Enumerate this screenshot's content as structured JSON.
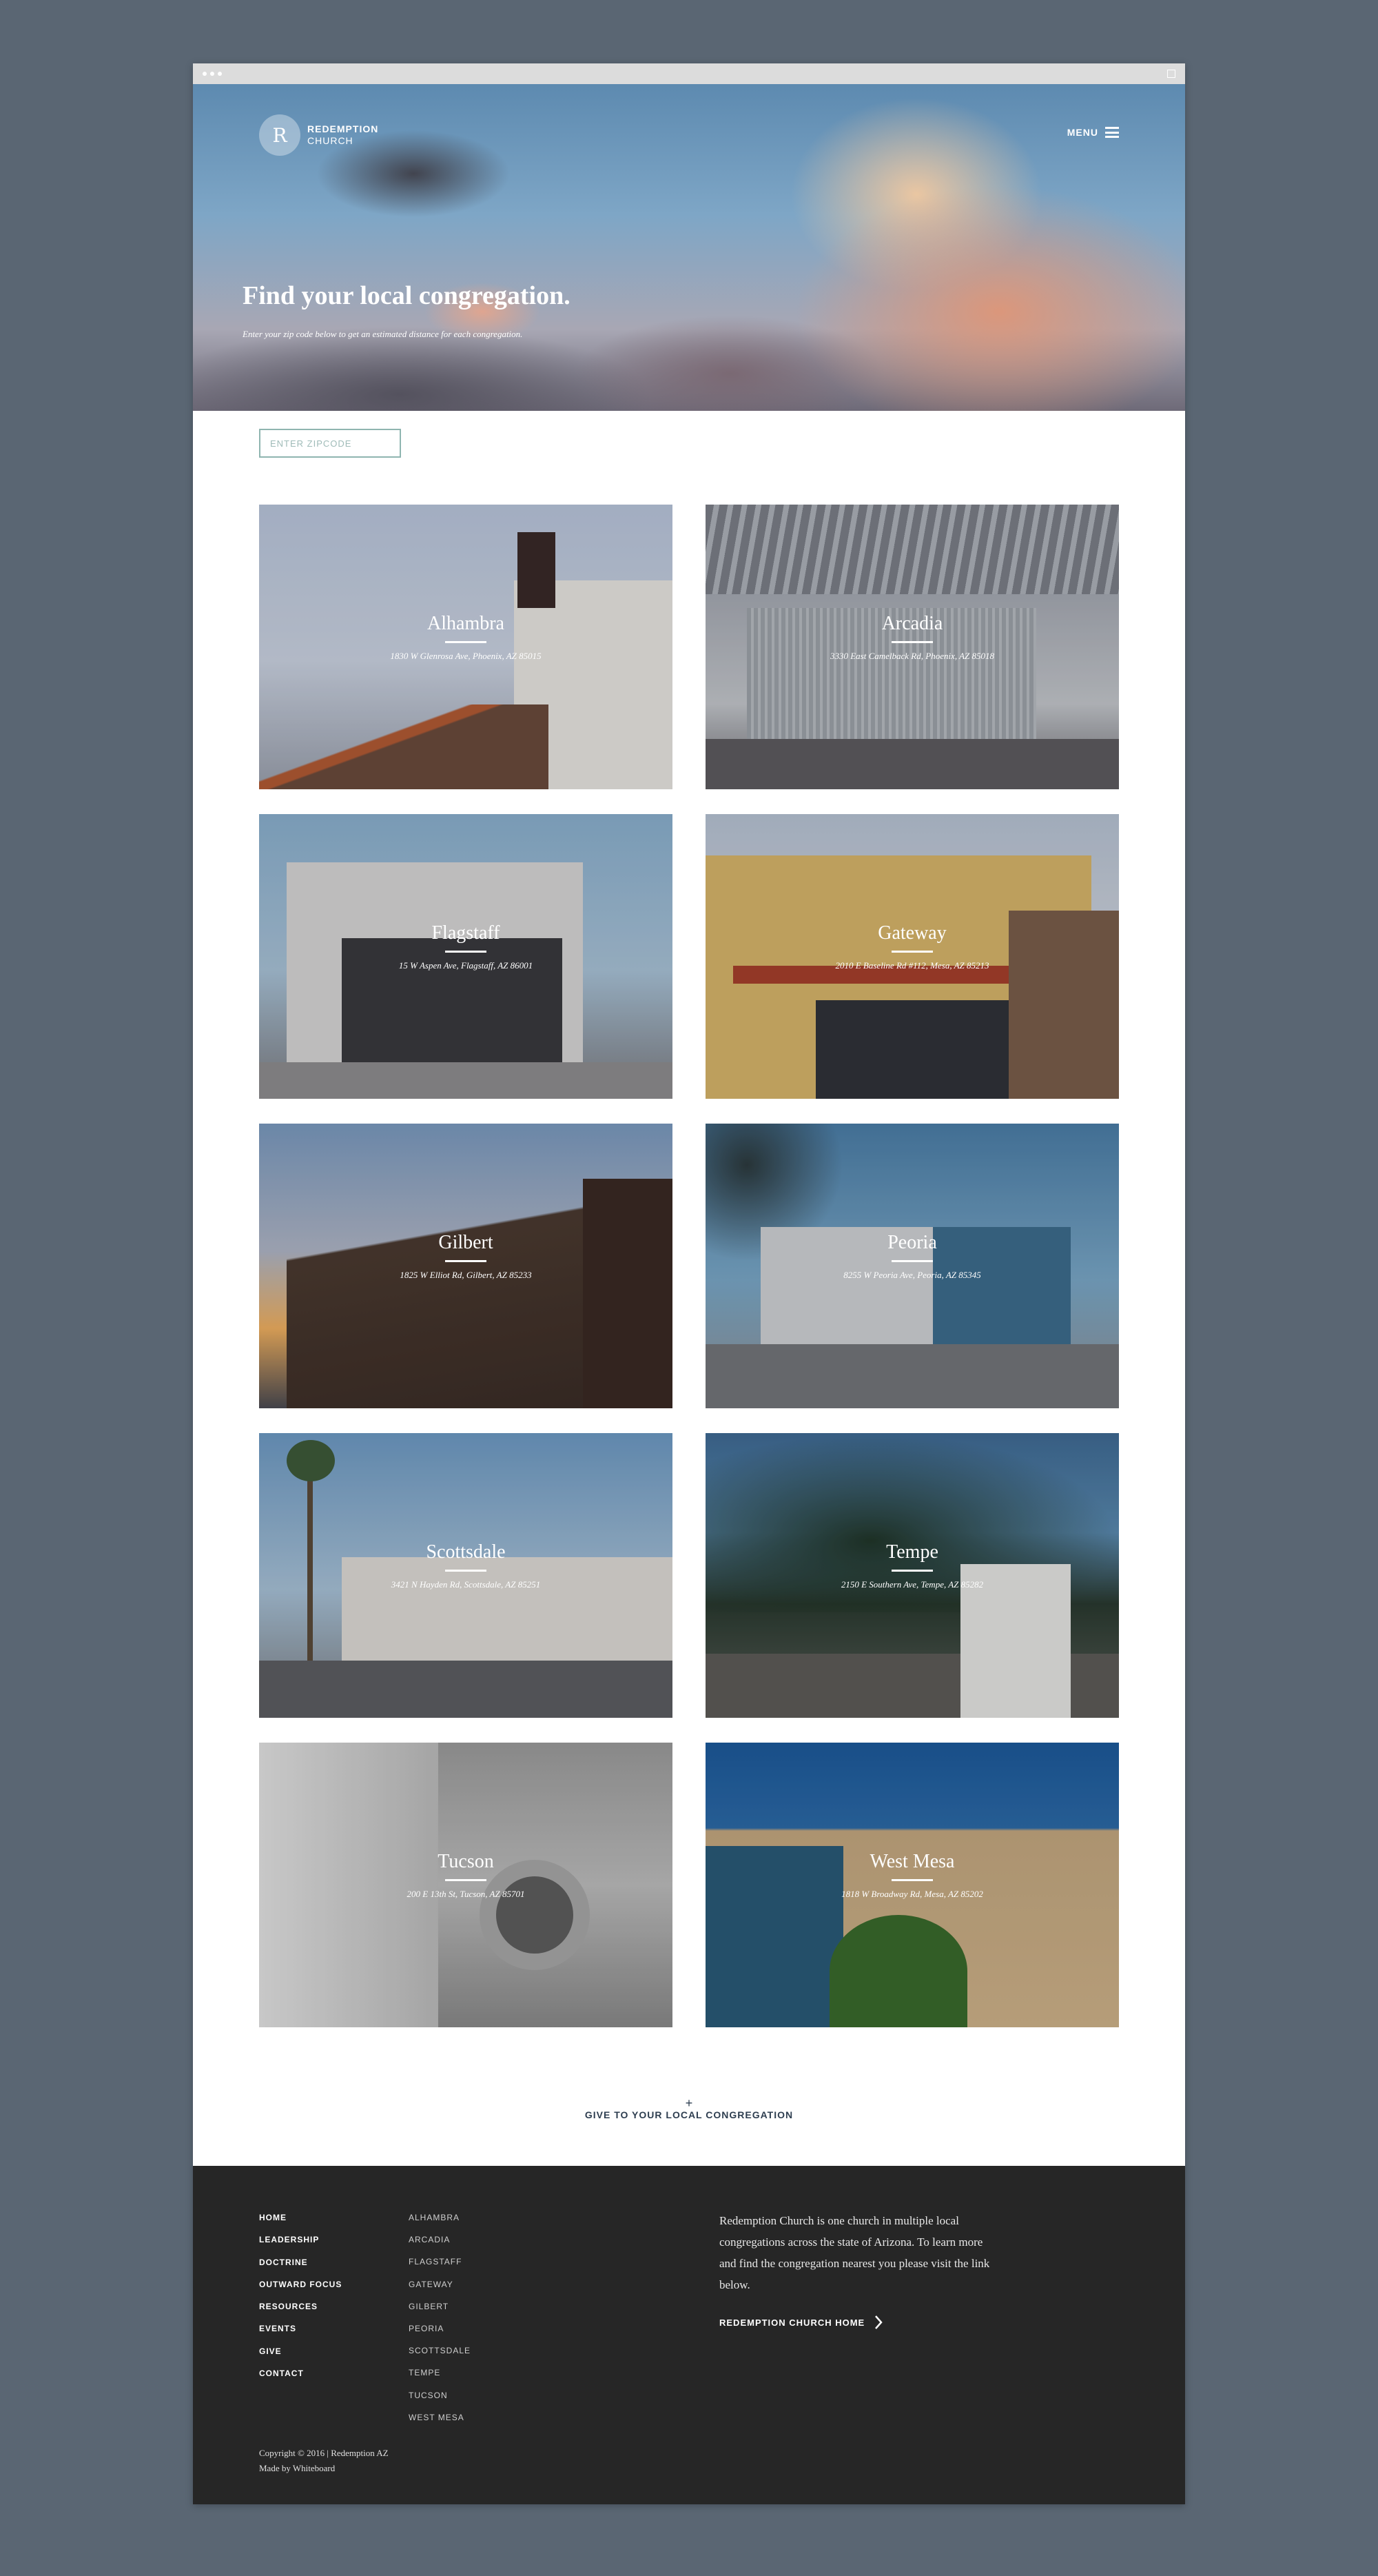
{
  "brand": {
    "mark": "R",
    "name_line1": "REDEMPTION",
    "name_line2": "CHURCH"
  },
  "header": {
    "menu_label": "MENU"
  },
  "hero": {
    "title": "Find your local congregation.",
    "subtitle": "Enter your zip code below to get an estimated distance for each congregation."
  },
  "search": {
    "placeholder": "ENTER ZIPCODE",
    "value": ""
  },
  "locations": [
    {
      "name": "Alhambra",
      "address": "1830 W Glenrosa Ave, Phoenix, AZ 85015"
    },
    {
      "name": "Arcadia",
      "address": "3330 East Camelback Rd, Phoenix, AZ 85018"
    },
    {
      "name": "Flagstaff",
      "address": "15 W Aspen Ave, Flagstaff, AZ 86001"
    },
    {
      "name": "Gateway",
      "address": "2010 E Baseline Rd #112, Mesa, AZ 85213"
    },
    {
      "name": "Gilbert",
      "address": "1825 W Elliot Rd, Gilbert, AZ 85233"
    },
    {
      "name": "Peoria",
      "address": "8255 W Peoria Ave, Peoria, AZ 85345"
    },
    {
      "name": "Scottsdale",
      "address": "3421 N Hayden Rd, Scottsdale, AZ 85251"
    },
    {
      "name": "Tempe",
      "address": "2150 E Southern Ave, Tempe, AZ 85282"
    },
    {
      "name": "Tucson",
      "address": "200 E 13th St, Tucson, AZ 85701"
    },
    {
      "name": "West Mesa",
      "address": "1818 W Broadway Rd, Mesa, AZ 85202"
    }
  ],
  "give": {
    "icon": "+",
    "label": "GIVE TO YOUR LOCAL CONGREGATION"
  },
  "footer": {
    "nav": [
      "HOME",
      "LEADERSHIP",
      "DOCTRINE",
      "OUTWARD FOCUS",
      "RESOURCES",
      "EVENTS",
      "GIVE",
      "CONTACT"
    ],
    "locations": [
      "ALHAMBRA",
      "ARCADIA",
      "FLAGSTAFF",
      "GATEWAY",
      "GILBERT",
      "PEORIA",
      "SCOTTSDALE",
      "TEMPE",
      "TUCSON",
      "WEST MESA"
    ],
    "about": "Redemption Church is one church in multiple local congregations across the state of Arizona. To learn more and find the congregation nearest you please visit the link below.",
    "home_link": "REDEMPTION CHURCH HOME",
    "copyright": "Copyright © 2016 | Redemption AZ",
    "credit": "Made by Whiteboard"
  },
  "colors": {
    "page_bg": "#5a6673",
    "footer_bg": "#262626",
    "accent": "#8fb5b0",
    "link_text": "#2e3e50"
  }
}
